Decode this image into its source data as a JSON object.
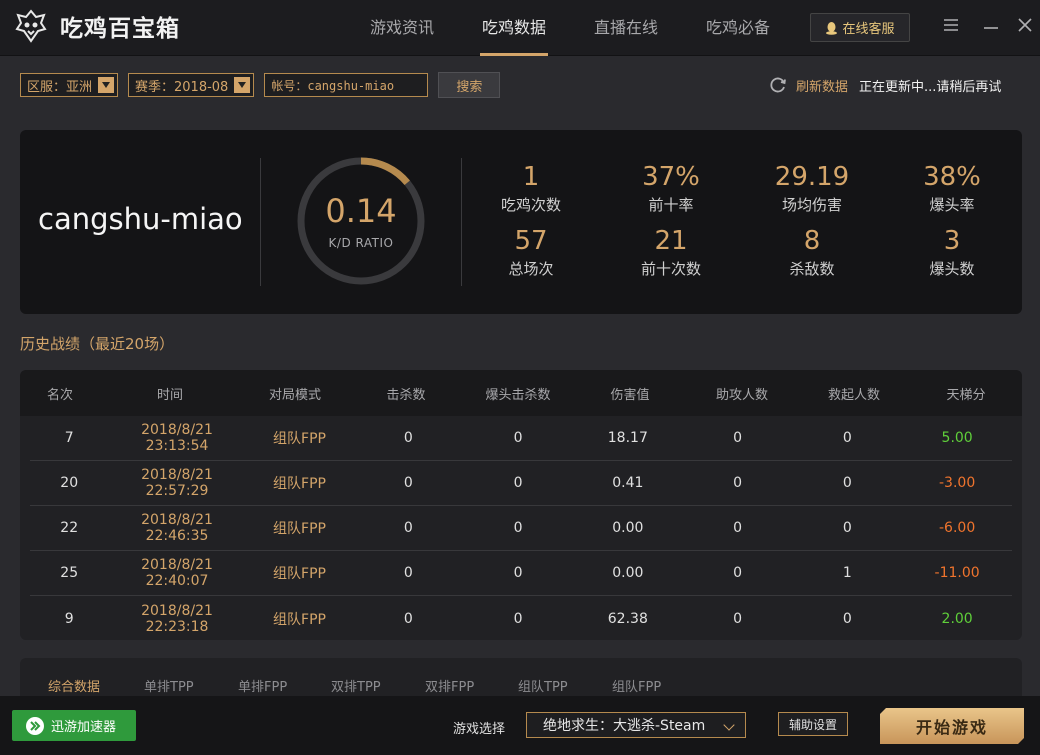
{
  "app": {
    "title": "吃鸡百宝箱"
  },
  "nav": [
    {
      "label": "游戏资讯"
    },
    {
      "label": "吃鸡数据",
      "active": true
    },
    {
      "label": "直播在线"
    },
    {
      "label": "吃鸡必备"
    }
  ],
  "header": {
    "service_label": "在线客服"
  },
  "filters": {
    "region": "区服：亚洲",
    "season": "赛季：2018-08",
    "account": "帐号：cangshu-miao",
    "search_label": "搜索",
    "refresh_label": "刷新数据",
    "status_text": "正在更新中...请稍后再试"
  },
  "summary": {
    "player": "cangshu-miao",
    "kd_value": "0.14",
    "kd_label": "K/D RATIO",
    "kd_ring_fraction": 0.14,
    "stats": [
      {
        "value": "1",
        "label": "吃鸡次数"
      },
      {
        "value": "37%",
        "label": "前十率"
      },
      {
        "value": "29.19",
        "label": "场均伤害"
      },
      {
        "value": "38%",
        "label": "爆头率"
      },
      {
        "value": "57",
        "label": "总场次"
      },
      {
        "value": "21",
        "label": "前十次数"
      },
      {
        "value": "8",
        "label": "杀敌数"
      },
      {
        "value": "3",
        "label": "爆头数"
      }
    ]
  },
  "history": {
    "title": "历史战绩（最近20场）",
    "columns": [
      "名次",
      "时间",
      "对局模式",
      "击杀数",
      "爆头击杀数",
      "伤害值",
      "助攻人数",
      "救起人数",
      "天梯分"
    ],
    "rows": [
      [
        "7",
        "2018/8/21 23:13:54",
        "组队FPP",
        "0",
        "0",
        "18.17",
        "0",
        "0",
        "5.00"
      ],
      [
        "20",
        "2018/8/21 22:57:29",
        "组队FPP",
        "0",
        "0",
        "0.41",
        "0",
        "0",
        "-3.00"
      ],
      [
        "22",
        "2018/8/21 22:46:35",
        "组队FPP",
        "0",
        "0",
        "0.00",
        "0",
        "0",
        "-6.00"
      ],
      [
        "25",
        "2018/8/21 22:40:07",
        "组队FPP",
        "0",
        "0",
        "0.00",
        "0",
        "1",
        "-11.00"
      ],
      [
        "9",
        "2018/8/21 22:23:18",
        "组队FPP",
        "0",
        "0",
        "62.38",
        "0",
        "0",
        "2.00"
      ]
    ]
  },
  "tabs": [
    {
      "label": "综合数据",
      "active": true
    },
    {
      "label": "单排TPP"
    },
    {
      "label": "单排FPP"
    },
    {
      "label": "双排TPP"
    },
    {
      "label": "双排FPP"
    },
    {
      "label": "组队TPP"
    },
    {
      "label": "组队FPP"
    }
  ],
  "footer": {
    "accelerator_label": "迅游加速器",
    "game_label": "游戏选择",
    "game_selected": "绝地求生：大逃杀-Steam",
    "assist_label": "辅助设置",
    "start_label": "开始游戏"
  },
  "colors": {
    "accent": "#d4a56a",
    "positive": "#5fcf3a",
    "negative": "#f0742d",
    "accelerator": "#2f9a3c"
  }
}
